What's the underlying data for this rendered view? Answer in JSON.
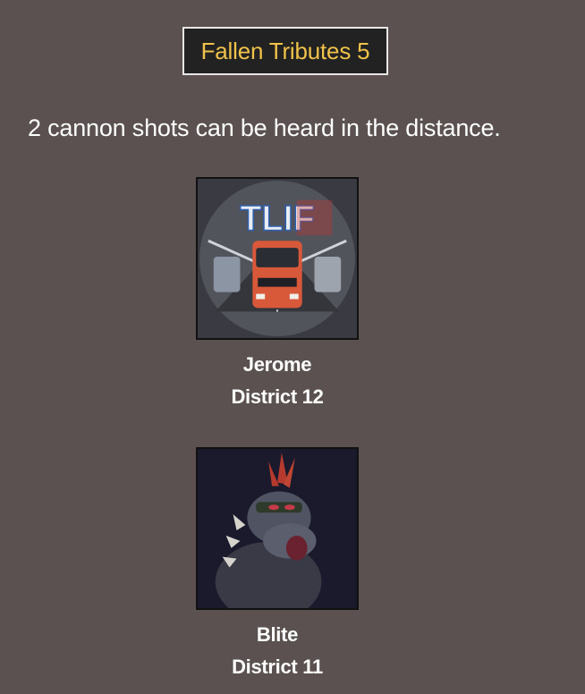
{
  "header": {
    "title": "Fallen Tributes 5"
  },
  "message": "2 cannon shots can be heard in the distance.",
  "tributes": [
    {
      "name": "Jerome",
      "district": "District 12",
      "avatar_icon": "trucks-logo-avatar",
      "avatar_text": "TLIF"
    },
    {
      "name": "Blite",
      "district": "District 11",
      "avatar_icon": "spiked-creature-avatar"
    }
  ]
}
